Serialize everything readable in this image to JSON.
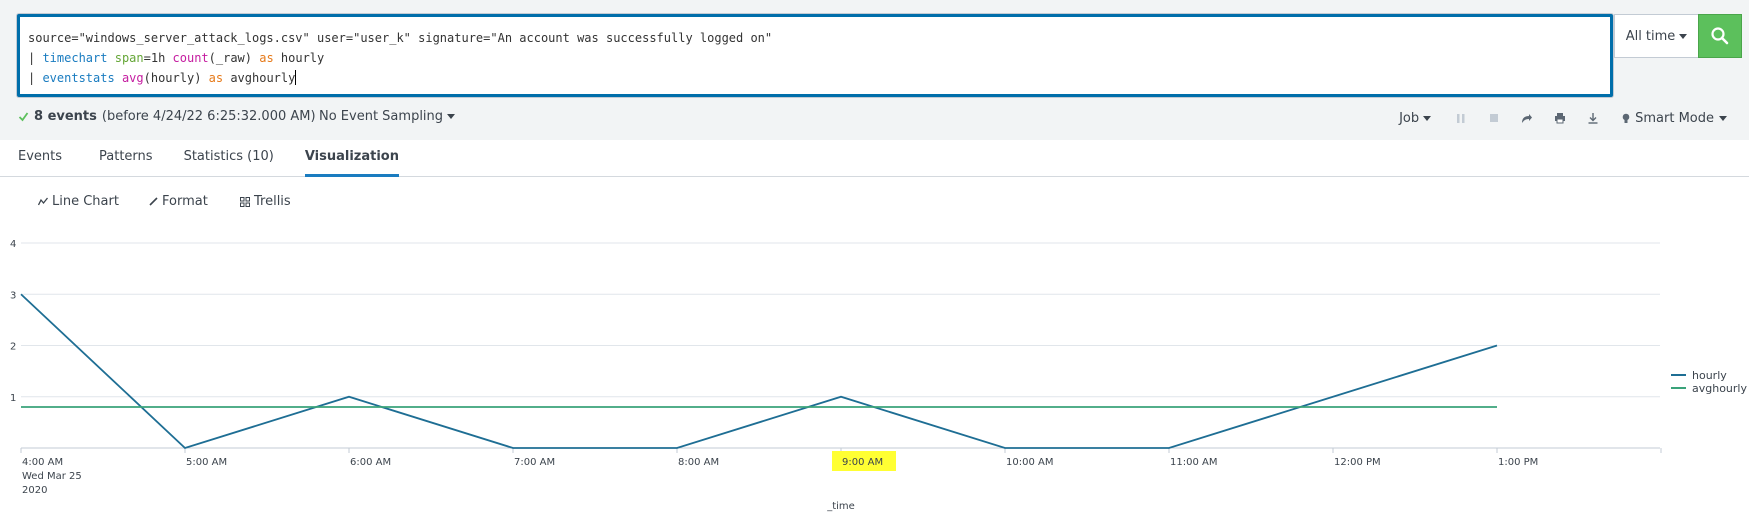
{
  "search": {
    "line1": "source=\"windows_server_attack_logs.csv\" user=\"user_k\" signature=\"An account was successfully logged on\"",
    "line2": {
      "pipe": "| ",
      "cmd": "timechart",
      "arg": "span",
      "arg_rest": "=1h ",
      "fn": "count",
      "fn_rest": "(_raw) ",
      "as": "as",
      "tail": " hourly"
    },
    "line3": {
      "pipe": "| ",
      "cmd": "eventstats",
      "fn": "avg",
      "fn_rest": "(hourly) ",
      "as": "as",
      "tail": " avghourly"
    },
    "time_range": "All time",
    "go_icon": "search-icon",
    "accent": "#5cc05c"
  },
  "status": {
    "count": "8 events",
    "detail": "(before 4/24/22 6:25:32.000 AM)",
    "sampling": "No Event Sampling",
    "job": "Job",
    "mode": "Smart Mode"
  },
  "tabs": [
    {
      "label": "Events"
    },
    {
      "label": "Patterns"
    },
    {
      "label": "Statistics (10)"
    },
    {
      "label": "Visualization",
      "active": true
    }
  ],
  "viz_toolbar": {
    "chart_type": "Line Chart",
    "format": "Format",
    "trellis": "Trellis"
  },
  "chart_data": {
    "type": "line",
    "x": [
      "4:00 AM",
      "5:00 AM",
      "6:00 AM",
      "7:00 AM",
      "8:00 AM",
      "9:00 AM",
      "10:00 AM",
      "11:00 AM",
      "12:00 PM",
      "1:00 PM"
    ],
    "x_extra": [
      "Wed Mar 25",
      "2020"
    ],
    "series": [
      {
        "name": "hourly",
        "values": [
          3,
          0,
          1,
          0,
          0,
          1,
          0,
          0,
          1,
          2
        ],
        "color": "#1e6e94"
      },
      {
        "name": "avghourly",
        "values": [
          0.8,
          0.8,
          0.8,
          0.8,
          0.8,
          0.8,
          0.8,
          0.8,
          0.8,
          0.8
        ],
        "color": "#3aa37a"
      }
    ],
    "yticks": [
      "1",
      "2",
      "3",
      "4"
    ],
    "ylim": [
      0,
      4
    ],
    "xlabel": "_time",
    "ylabel": "",
    "highlight": "9:00 AM",
    "highlight_color": "#ffff33",
    "grid": true,
    "legend": "right"
  }
}
